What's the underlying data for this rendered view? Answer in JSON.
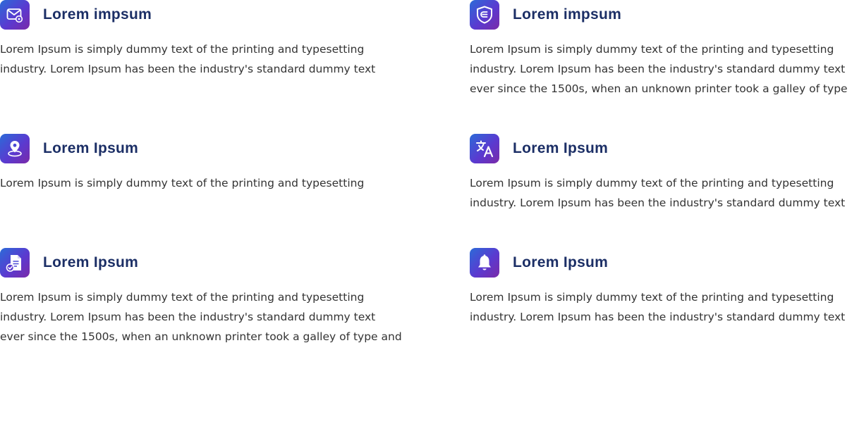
{
  "features": [
    {
      "icon": "mail-settings-icon",
      "title": "Lorem impsum",
      "text": "Lorem Ipsum is simply dummy text of the printing and typesetting\nindustry. Lorem Ipsum has been the industry's standard dummy text"
    },
    {
      "icon": "shield-icon",
      "title": "Lorem impsum",
      "text": "Lorem Ipsum is simply dummy text of the printing and typesetting\nindustry. Lorem Ipsum has been the industry's standard dummy text\n ever since the 1500s, when an unknown printer took a galley of type"
    },
    {
      "icon": "location-pin-icon",
      "title": "Lorem Ipsum",
      "text": "Lorem Ipsum is simply dummy text of the printing and typesetting"
    },
    {
      "icon": "translate-icon",
      "title": "Lorem Ipsum",
      "text": "Lorem Ipsum is simply dummy text of the printing and typesetting\nindustry. Lorem Ipsum has been the industry's standard dummy text"
    },
    {
      "icon": "document-check-icon",
      "title": "Lorem Ipsum",
      "text": "Lorem Ipsum is simply dummy text of the printing and typesetting\nindustry. Lorem Ipsum has been the industry's standard dummy text\never since the 1500s, when an unknown printer took a galley of type and"
    },
    {
      "icon": "bell-icon",
      "title": "Lorem Ipsum",
      "text": "Lorem Ipsum is simply dummy text of the printing and typesetting\nindustry. Lorem Ipsum has been the industry's standard dummy text"
    }
  ],
  "colors": {
    "title": "#1c2f66",
    "body_text": "#333333",
    "icon_gradient_start": "#2c6ad8",
    "icon_gradient_end": "#7a2aa8"
  }
}
